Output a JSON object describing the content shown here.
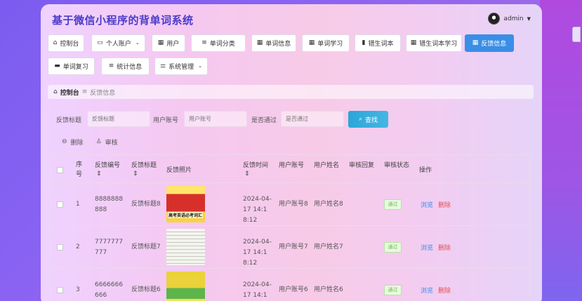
{
  "app": {
    "title": "基于微信小程序的背单词系统",
    "username": "admin"
  },
  "nav": [
    {
      "label": "控制台",
      "icon": "home-icon"
    },
    {
      "label": "个人账户",
      "icon": "account-icon",
      "dropdown": true
    },
    {
      "label": "用户",
      "icon": "grid-icon"
    },
    {
      "label": "单词分类",
      "icon": "list-icon"
    },
    {
      "label": "单词信息",
      "icon": "grid-icon"
    },
    {
      "label": "单词学习",
      "icon": "grid-icon"
    },
    {
      "label": "错生词本",
      "icon": "bar-chart-icon"
    },
    {
      "label": "错生词本学习",
      "icon": "grid-icon"
    },
    {
      "label": "反馈信息",
      "icon": "grid-icon",
      "active": true
    },
    {
      "label": "单词复习",
      "icon": "desktop-icon"
    },
    {
      "label": "统计信息",
      "icon": "list-icon"
    },
    {
      "label": "系统管理",
      "icon": "sliders-icon",
      "dropdown": true
    }
  ],
  "breadcrumb": {
    "home": "控制台",
    "separator": "≡",
    "current": "反馈信息"
  },
  "search": {
    "fields": [
      {
        "label": "反馈标题",
        "placeholder": "反馈标题"
      },
      {
        "label": "用户账号",
        "placeholder": "用户账号"
      },
      {
        "label": "是否通过",
        "placeholder": "是否通过"
      }
    ],
    "button_label": "查找"
  },
  "actions": {
    "delete_label": "删除",
    "audit_label": "审核"
  },
  "table": {
    "headers": {
      "seq": "序号",
      "code": "反馈编号",
      "title": "反馈标题",
      "photo": "反馈照片",
      "time": "反馈时间",
      "account": "用户账号",
      "name": "用户姓名",
      "reply": "审核回复",
      "status": "审核状态",
      "ops": "操作"
    },
    "rows": [
      {
        "seq": "1",
        "code": "8888888888",
        "title": "反馈标题8",
        "photo_caption": "高考英语必考词汇",
        "time": "2024-04-17 14:18:12",
        "account": "用户账号8",
        "name": "用户姓名8",
        "status": "通过",
        "view": "浏览",
        "delete": "删除"
      },
      {
        "seq": "2",
        "code": "7777777777",
        "title": "反馈标题7",
        "photo_caption": "",
        "time": "2024-04-17 14:18:12",
        "account": "用户账号7",
        "name": "用户姓名7",
        "status": "通过",
        "view": "浏览",
        "delete": "删除"
      },
      {
        "seq": "3",
        "code": "6666666666",
        "title": "反馈标题6",
        "photo_caption": "",
        "time": "2024-04-17 14:18:12",
        "account": "用户账号6",
        "name": "用户姓名6",
        "status": "通过",
        "view": "浏览",
        "delete": "删除"
      }
    ]
  },
  "colors": {
    "accent": "#3a8ee6",
    "danger": "#e15252",
    "success": "#67c23a",
    "title": "#4a3bc8"
  }
}
